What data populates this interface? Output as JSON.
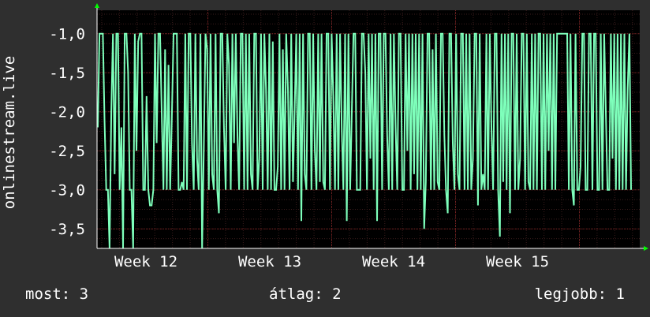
{
  "chart_data": {
    "type": "line",
    "ylabel": "onlinestream.live",
    "xlabel": "",
    "title": "",
    "x_ticks": [
      "Week 12",
      "Week 13",
      "Week 14",
      "Week 15"
    ],
    "y_ticks": [
      "-1,0",
      "-1,5",
      "-2,0",
      "-2,5",
      "-3,0",
      "-3,5"
    ],
    "ylim": [
      -3.75,
      -0.7
    ],
    "grid": true,
    "colors": {
      "background": "#2f2f2f",
      "plot_bg": "#000000",
      "grid": "#7a2020",
      "line": "#7effbb",
      "axis_arrow": "#00ff00"
    },
    "series": [
      {
        "values": [
          -2.2,
          -1.0,
          -1.0,
          -1.0,
          -2.1,
          -3.0,
          -3.0,
          -3.75,
          -2.0,
          -1.0,
          -2.8,
          -1.0,
          -1.0,
          -3.0,
          -2.2,
          -3.75,
          -1.0,
          -1.0,
          -1.5,
          -3.0,
          -3.0,
          -3.75,
          -1.0,
          -2.5,
          -1.1,
          -1.0,
          -1.0,
          -3.0,
          -3.0,
          -1.8,
          -3.0,
          -3.2,
          -3.2,
          -3.0,
          -1.0,
          -2.4,
          -1.0,
          -1.0,
          -2.0,
          -3.0,
          -1.2,
          -3.0,
          -1.4,
          -3.0,
          -2.1,
          -1.0,
          -1.0,
          -1.0,
          -3.0,
          -3.0,
          -2.9,
          -3.0,
          -1.0,
          -3.0,
          -1.0,
          -1.0,
          -2.4,
          -3.0,
          -1.0,
          -2.6,
          -3.0,
          -1.0,
          -3.75,
          -2.5,
          -1.0,
          -1.2,
          -3.0,
          -1.0,
          -2.8,
          -3.0,
          -1.0,
          -3.0,
          -3.3,
          -1.0,
          -1.0,
          -2.2,
          -3.0,
          -1.0,
          -1.4,
          -3.0,
          -1.0,
          -2.4,
          -1.0,
          -2.3,
          -3.0,
          -1.0,
          -1.0,
          -3.0,
          -1.0,
          -3.0,
          -1.0,
          -2.8,
          -3.0,
          -1.0,
          -1.0,
          -3.0,
          -2.6,
          -1.0,
          -3.0,
          -1.0,
          -1.7,
          -3.0,
          -1.0,
          -3.0,
          -1.1,
          -3.0,
          -3.0,
          -2.7,
          -1.0,
          -3.0,
          -1.2,
          -3.0,
          -1.0,
          -1.7,
          -3.0,
          -1.0,
          -2.9,
          -2.0,
          -1.0,
          -3.0,
          -1.0,
          -3.4,
          -1.0,
          -2.8,
          -3.0,
          -1.0,
          -1.0,
          -3.0,
          -1.0,
          -2.5,
          -3.0,
          -1.0,
          -2.9,
          -1.0,
          -2.9,
          -3.0,
          -1.0,
          -1.0,
          -3.0,
          -1.0,
          -1.8,
          -3.0,
          -1.0,
          -3.0,
          -1.0,
          -2.2,
          -3.0,
          -1.0,
          -3.4,
          -1.0,
          -3.0,
          -2.0,
          -1.0,
          -1.0,
          -3.0,
          -3.0,
          -3.0,
          -1.0,
          -1.0,
          -1.5,
          -3.0,
          -1.0,
          -2.6,
          -1.0,
          -3.0,
          -1.0,
          -3.4,
          -1.0,
          -1.0,
          -3.0,
          -1.0,
          -1.0,
          -2.3,
          -3.0,
          -1.0,
          -3.0,
          -1.0,
          -2.2,
          -3.0,
          -1.0,
          -1.0,
          -3.0,
          -3.0,
          -1.0,
          -2.5,
          -1.0,
          -3.0,
          -1.0,
          -2.8,
          -1.0,
          -3.0,
          -1.0,
          -3.0,
          -1.0,
          -3.5,
          -2.9,
          -1.0,
          -1.0,
          -3.0,
          -1.2,
          -3.0,
          -1.0,
          -2.9,
          -3.0,
          -1.0,
          -1.0,
          -2.3,
          -3.0,
          -3.3,
          -1.0,
          -1.0,
          -2.4,
          -3.0,
          -1.0,
          -2.8,
          -3.0,
          -1.0,
          -1.0,
          -3.0,
          -1.0,
          -3.0,
          -1.0,
          -3.0,
          -2.6,
          -1.0,
          -1.0,
          -3.2,
          -1.0,
          -3.0,
          -2.8,
          -3.0,
          -1.0,
          -3.0,
          -1.0,
          -2.2,
          -3.0,
          -1.0,
          -1.0,
          -3.0,
          -3.6,
          -1.0,
          -2.9,
          -1.0,
          -3.0,
          -1.0,
          -3.3,
          -1.0,
          -1.0,
          -3.0,
          -1.0,
          -3.0,
          -2.6,
          -1.0,
          -1.0,
          -3.0,
          -1.0,
          -2.9,
          -3.0,
          -1.0,
          -3.0,
          -1.0,
          -3.0,
          -1.0,
          -1.0,
          -3.0,
          -1.0,
          -3.0,
          -1.0,
          -2.5,
          -1.0,
          -3.0,
          -1.0,
          -3.0,
          -1.0,
          -1.0,
          -1.0,
          -1.0,
          -1.0,
          -1.0,
          -1.0,
          -3.0,
          -1.0,
          -3.0,
          -3.2,
          -1.0,
          -3.0,
          -3.0,
          -2.7,
          -1.0,
          -1.0,
          -3.0,
          -3.0,
          -1.0,
          -1.0,
          -3.0,
          -1.0,
          -1.0,
          -3.0,
          -3.0,
          -1.0,
          -3.0,
          -1.0,
          -2.0,
          -3.0,
          -3.0,
          -1.0,
          -2.6,
          -1.0,
          -3.0,
          -1.0,
          -3.0,
          -1.0,
          -3.0,
          -1.0,
          -3.0,
          -1.7,
          -1.0,
          -3.0
        ]
      }
    ]
  },
  "legend": {
    "now_label": "most:",
    "now_value": "3",
    "avg_label": "átlag:",
    "avg_value": "2",
    "best_label": "legjobb:",
    "best_value": "1"
  }
}
